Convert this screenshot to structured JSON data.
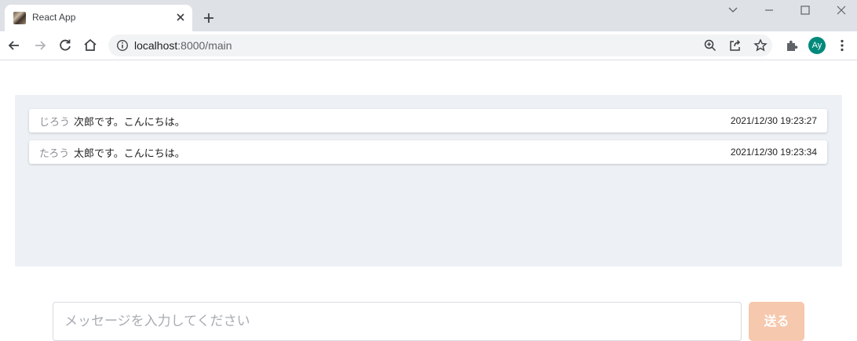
{
  "browser": {
    "tab_title": "React App",
    "url_host": "localhost",
    "url_rest": ":8000/main",
    "profile_initials": "Ay",
    "profile_color": "#00897b"
  },
  "chat": {
    "messages": [
      {
        "name": "じろう",
        "text": "次郎です。こんにちは。",
        "time": "2021/12/30 19:23:27"
      },
      {
        "name": "たろう",
        "text": "太郎です。こんにちは。",
        "time": "2021/12/30 19:23:34"
      }
    ]
  },
  "composer": {
    "placeholder": "メッセージを入力してください",
    "value": "",
    "send_label": "送る",
    "send_color": "#f6c8ad"
  }
}
